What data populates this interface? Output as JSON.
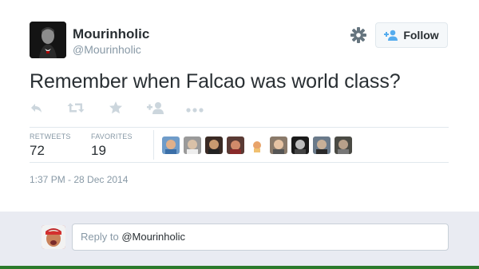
{
  "user": {
    "name": "Mourinholic",
    "handle": "@Mourinholic"
  },
  "follow_button": {
    "label": "Follow"
  },
  "tweet": {
    "text": "Remember when Falcao was world class?",
    "timestamp": "1:37 PM - 28 Dec 2014"
  },
  "actions": [
    "reply-icon",
    "retweet-icon",
    "favorite-icon",
    "add-user-icon",
    "more-icon"
  ],
  "stats": {
    "retweets_label": "RETWEETS",
    "retweets_value": "72",
    "favorites_label": "FAVORITES",
    "favorites_value": "19"
  },
  "reply": {
    "placeholder_prefix": "Reply to ",
    "placeholder_handle": "@Mourinholic"
  },
  "colors": {
    "text": "#292f33",
    "muted": "#8899a6",
    "follow_icon": "#55acee",
    "reply_bg": "#e9ebf2"
  }
}
